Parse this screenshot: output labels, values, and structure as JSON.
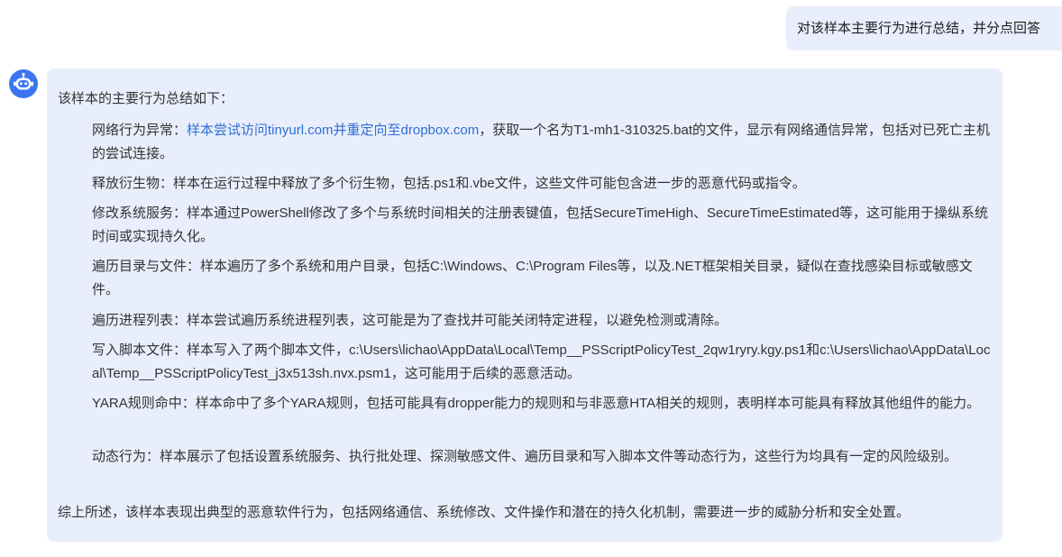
{
  "user_message": {
    "text": "对该样本主要行为进行总结，并分点回答"
  },
  "assistant_avatar": {
    "icon": "robot-icon",
    "color": "#3b76f0"
  },
  "assistant_message": {
    "intro": "该样本的主要行为总结如下：",
    "items": [
      {
        "lead": "网络行为异常：",
        "link": "样本尝试访问tinyurl.com并重定向至dropbox.com",
        "rest": "，获取一个名为T1-mh1-310325.bat的文件，显示有网络通信异常，包括对已死亡主机的尝试连接。"
      },
      {
        "lead": "释放衍生物：",
        "rest": "样本在运行过程中释放了多个衍生物，包括.ps1和.vbe文件，这些文件可能包含进一步的恶意代码或指令。"
      },
      {
        "lead": "修改系统服务：",
        "rest": "样本通过PowerShell修改了多个与系统时间相关的注册表键值，包括SecureTimeHigh、SecureTimeEstimated等，这可能用于操纵系统时间或实现持久化。"
      },
      {
        "lead": "遍历目录与文件：",
        "rest": "样本遍历了多个系统和用户目录，包括C:\\Windows、C:\\Program Files等，以及.NET框架相关目录，疑似在查找感染目标或敏感文件。"
      },
      {
        "lead": "遍历进程列表：",
        "rest": "样本尝试遍历系统进程列表，这可能是为了查找并可能关闭特定进程，以避免检测或清除。"
      },
      {
        "lead": "写入脚本文件：",
        "rest": "样本写入了两个脚本文件，c:\\Users\\lichao\\AppData\\Local\\Temp__PSScriptPolicyTest_2qw1ryry.kgy.ps1和c:\\Users\\lichao\\AppData\\Local\\Temp__PSScriptPolicyTest_j3x513sh.nvx.psm1，这可能用于后续的恶意活动。"
      },
      {
        "lead": "YARA规则命中：",
        "rest": "样本命中了多个YARA规则，包括可能具有dropper能力的规则和与非恶意HTA相关的规则，表明样本可能具有释放其他组件的能力。"
      },
      {
        "lead": "动态行为：",
        "rest": "样本展示了包括设置系统服务、执行批处理、探测敏感文件、遍历目录和写入脚本文件等动态行为，这些行为均具有一定的风险级别。"
      }
    ],
    "summary": "综上所述，该样本表现出典型的恶意软件行为，包括网络通信、系统修改、文件操作和潜在的持久化机制，需要进一步的威胁分析和安全处置。"
  },
  "colors": {
    "bubble_bg": "#e8eefb",
    "link": "#2f6fd6",
    "text": "#333333"
  }
}
